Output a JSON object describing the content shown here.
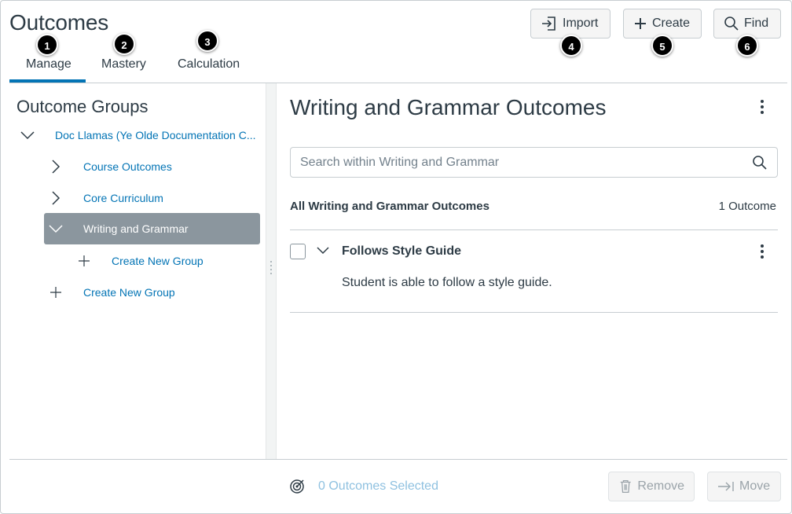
{
  "page": {
    "title": "Outcomes"
  },
  "tabs": [
    {
      "label": "Manage",
      "badge": "1"
    },
    {
      "label": "Mastery",
      "badge": "2"
    },
    {
      "label": "Calculation",
      "badge": "3"
    }
  ],
  "header_buttons": {
    "import": {
      "label": "Import",
      "badge": "4",
      "icon": "import-icon"
    },
    "create": {
      "label": "Create",
      "badge": "5",
      "icon": "plus-icon"
    },
    "find": {
      "label": "Find",
      "badge": "6",
      "icon": "search-icon"
    }
  },
  "sidebar": {
    "title": "Outcome Groups",
    "tree": [
      {
        "label": "Doc Llamas (Ye Olde Documentation C...",
        "icon": "chevron-down-icon"
      },
      {
        "label": "Course Outcomes",
        "icon": "chevron-right-icon"
      },
      {
        "label": "Core Curriculum",
        "icon": "chevron-right-icon"
      },
      {
        "label": "Writing and Grammar",
        "icon": "chevron-down-icon",
        "selected": true
      },
      {
        "label": "Create New Group",
        "icon": "plus-icon"
      },
      {
        "label": "Create New Group",
        "icon": "plus-icon"
      }
    ]
  },
  "main": {
    "title": "Writing and Grammar Outcomes",
    "search_placeholder": "Search within Writing and Grammar",
    "list_header": "All Writing and Grammar Outcomes",
    "count": "1 Outcome",
    "outcomes": [
      {
        "title": "Follows Style Guide",
        "description": "Student is able to follow a style guide."
      }
    ]
  },
  "footer": {
    "selected": "0 Outcomes Selected",
    "remove": "Remove",
    "move": "Move"
  },
  "colors": {
    "link": "#0374b5",
    "text": "#2d3b45",
    "selected_bg": "#8b969e",
    "tab_underline": "#0374b5",
    "disabled": "#9aa3a9"
  }
}
